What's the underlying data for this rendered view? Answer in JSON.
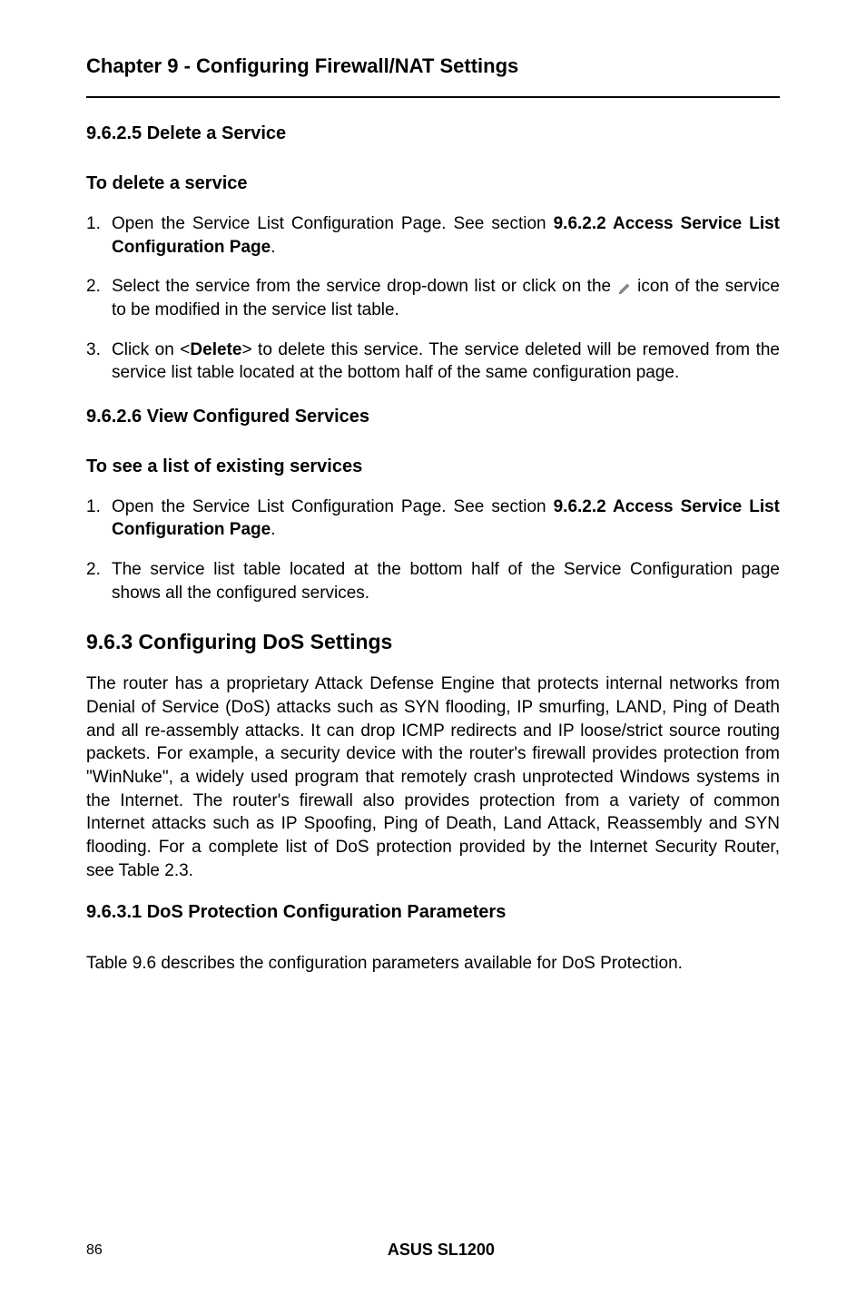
{
  "chapter": {
    "title": "Chapter 9 - Configuring Firewall/NAT Settings"
  },
  "section_9625": {
    "heading": "9.6.2.5 Delete a Service",
    "subheading": "To delete a service",
    "items": [
      {
        "prefix": "Open the Service List Configuration Page. See section ",
        "bold1": "9.6.2.2 Access Service List Configuration Page",
        "suffix": "."
      },
      {
        "text_a": "Select the service from the service drop-down list or click on the ",
        "text_b": " icon of the service to be modified in the service list table."
      },
      {
        "prefix": "Click on <",
        "bold1": "Delete",
        "suffix": "> to delete this service. The service deleted will be removed from the service list table located at the bottom half of the same configuration page."
      }
    ]
  },
  "section_9626": {
    "heading": "9.6.2.6 View Configured Services",
    "subheading": "To see a list of existing services",
    "items": [
      {
        "prefix": "Open the Service List Configuration Page. See section ",
        "bold1": "9.6.2.2 Access Service List Configuration Page",
        "suffix": "."
      },
      {
        "text": "The service list table located at the bottom half of the Service Configuration page shows all the configured services."
      }
    ]
  },
  "section_963": {
    "heading": "9.6.3 Configuring DoS Settings",
    "body": "The router has a proprietary Attack Defense Engine that protects internal networks from Denial of Service (DoS) attacks such as SYN flooding, IP smurfing, LAND, Ping of Death and all re-assembly attacks. It can drop ICMP redirects and IP loose/strict source routing packets. For example, a security device with the router's firewall provides protection from \"WinNuke\", a widely used program that remotely crash unprotected Windows systems in the Internet. The router's firewall also provides protection from a variety of common Internet attacks such as IP Spoofing, Ping of Death, Land Attack, Reassembly and SYN flooding. For a complete list of DoS protection provided by the Internet Security Router, see Table 2.3."
  },
  "section_9631": {
    "heading": "9.6.3.1 DoS Protection Configuration Parameters",
    "body": "Table 9.6 describes the configuration parameters available for DoS Protection."
  },
  "footer": {
    "page": "86",
    "product": "ASUS SL1200"
  }
}
